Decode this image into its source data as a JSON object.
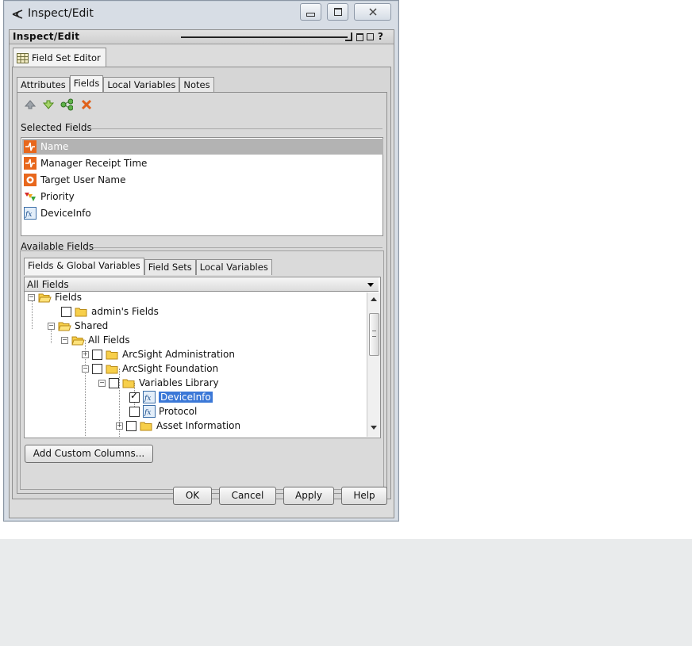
{
  "window": {
    "title": "Inspect/Edit",
    "buttons": [
      "minimize",
      "maximize",
      "close"
    ]
  },
  "panel": {
    "title": "Inspect/Edit",
    "controls": [
      "minimize",
      "restore",
      "?"
    ]
  },
  "editor_tab": "Field Set Editor",
  "tabs": [
    "Attributes",
    "Fields",
    "Local Variables",
    "Notes"
  ],
  "active_tab": "Fields",
  "toolbar": {
    "icons": [
      "move-up-icon",
      "move-down-icon",
      "add-field-icon",
      "delete-icon"
    ]
  },
  "selected_fields": {
    "label": "Selected Fields",
    "items": [
      {
        "label": "Name",
        "icon": "field-icon",
        "selected": true
      },
      {
        "label": "Manager Receipt Time",
        "icon": "field-icon"
      },
      {
        "label": "Target User Name",
        "icon": "user-field-icon"
      },
      {
        "label": "Priority",
        "icon": "priority-icon"
      },
      {
        "label": "DeviceInfo",
        "icon": "variable-icon"
      }
    ]
  },
  "available_fields": {
    "label": "Available Fields",
    "tabs": [
      "Fields & Global Variables",
      "Field Sets",
      "Local Variables"
    ],
    "active_tab": "Fields & Global Variables",
    "filter": "All Fields",
    "tree": [
      {
        "label": "Fields",
        "level": 0,
        "expander": "minus",
        "checkbox": false,
        "icon": "open-folder"
      },
      {
        "label": "admin's Fields",
        "level": 1,
        "checkbox": true,
        "checked": false,
        "icon": "folder"
      },
      {
        "label": "Shared",
        "level": 1,
        "expander": "minus",
        "checkbox": false,
        "icon": "open-folder"
      },
      {
        "label": "All Fields",
        "level": 2,
        "expander": "minus",
        "checkbox": false,
        "icon": "open-folder"
      },
      {
        "label": "ArcSight Administration",
        "level": 3,
        "expander": "plus",
        "checkbox": true,
        "checked": false,
        "icon": "folder"
      },
      {
        "label": "ArcSight Foundation",
        "level": 3,
        "expander": "minus",
        "checkbox": true,
        "checked": false,
        "icon": "folder"
      },
      {
        "label": "Variables Library",
        "level": 4,
        "expander": "minus",
        "checkbox": true,
        "checked": false,
        "icon": "folder"
      },
      {
        "label": "DeviceInfo",
        "level": 5,
        "checkbox": true,
        "checked": true,
        "icon": "variable",
        "selected": true
      },
      {
        "label": "Protocol",
        "level": 5,
        "checkbox": true,
        "checked": false,
        "icon": "variable"
      },
      {
        "label": "Asset Information",
        "level": 4,
        "expander": "plus",
        "checkbox": true,
        "checked": false,
        "icon": "folder"
      }
    ]
  },
  "buttons": {
    "add_custom": "Add Custom Columns...",
    "ok": "OK",
    "cancel": "Cancel",
    "apply": "Apply",
    "help": "Help"
  },
  "colors": {
    "selection_blue": "#3b78d7",
    "selection_gray": "#b3b3b3",
    "field_orange": "#e8671c"
  }
}
